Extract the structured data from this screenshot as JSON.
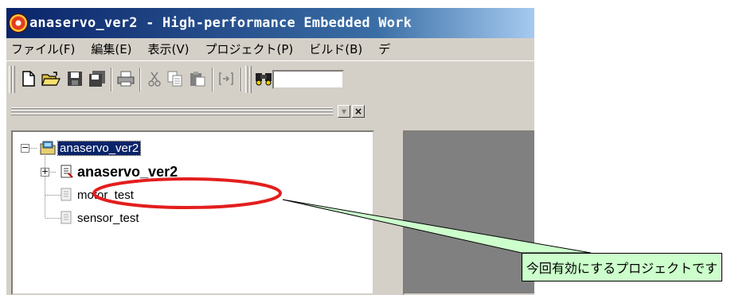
{
  "window": {
    "title": "anaservo_ver2 - High-performance Embedded Work"
  },
  "menu": [
    "ファイル(F)",
    "編集(E)",
    "表示(V)",
    "プロジェクト(P)",
    "ビルド(B)",
    "デ"
  ],
  "toolbar": {
    "icons": [
      "new-file-icon",
      "open-folder-icon",
      "save-icon",
      "save-all-icon",
      "print-icon",
      "cut-icon",
      "copy-icon",
      "paste-icon",
      "insert-icon",
      "find-icon"
    ]
  },
  "workspace": {
    "header_buttons": [
      "▾",
      "×"
    ]
  },
  "tree": {
    "root": "anaservo_ver2",
    "children": [
      "anaservo_ver2",
      "motor_test",
      "sensor_test"
    ]
  },
  "callout": {
    "text": "今回有効にするプロジェクトです",
    "fill": "#ccffcc",
    "highlight_color": "#e31e1e"
  }
}
